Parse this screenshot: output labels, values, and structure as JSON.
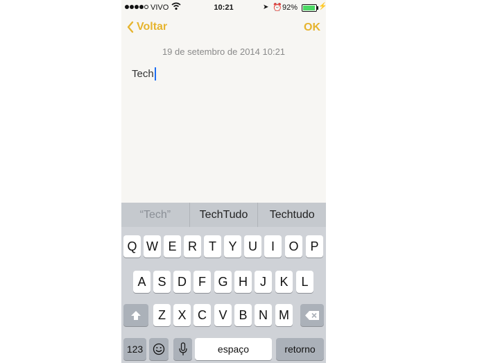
{
  "status_bar": {
    "carrier": "VIVO",
    "time": "10:21",
    "battery_percent": "92%",
    "battery_level": 0.92,
    "icons": [
      "signal-dots-icon",
      "wifi-icon",
      "location-arrow-icon",
      "alarm-clock-icon",
      "battery-icon",
      "charging-bolt-icon"
    ]
  },
  "nav": {
    "back_label": "Voltar",
    "done_label": "OK",
    "accent_color": "#e6b42e"
  },
  "note": {
    "date": "19 de setembro de 2014 10:21",
    "text": "Tech"
  },
  "keyboard": {
    "suggestions": [
      "“Tech”",
      "TechTudo",
      "Techtudo"
    ],
    "rows": [
      [
        "Q",
        "W",
        "E",
        "R",
        "T",
        "Y",
        "U",
        "I",
        "O",
        "P"
      ],
      [
        "A",
        "S",
        "D",
        "F",
        "G",
        "H",
        "J",
        "K",
        "L"
      ],
      [
        "Z",
        "X",
        "C",
        "V",
        "B",
        "N",
        "M"
      ]
    ],
    "numbers_label": "123",
    "space_label": "espaço",
    "return_label": "retorno",
    "special_icons": [
      "shift-icon",
      "backspace-icon",
      "emoji-icon",
      "microphone-icon"
    ]
  }
}
